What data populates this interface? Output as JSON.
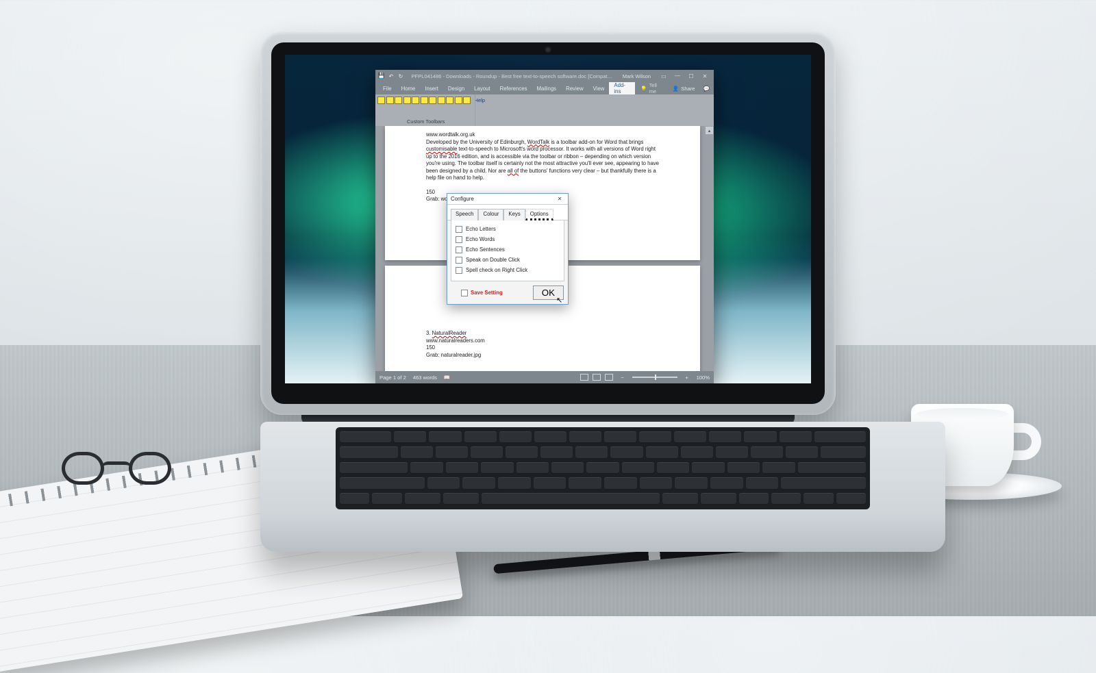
{
  "title": {
    "doc": "PFPL041486 - Downloads - Roundup - Best free text-to-speech software.doc [Compat…",
    "user": "Mark Wilson"
  },
  "menu": {
    "items": [
      "File",
      "Home",
      "Insert",
      "Design",
      "Layout",
      "References",
      "Mailings",
      "Review",
      "View",
      "Add-ins"
    ],
    "active": "Add-ins",
    "tell_me": "Tell me",
    "share": "Share"
  },
  "ribbon": {
    "help": "Help",
    "group": "Custom Toolbars"
  },
  "doc": {
    "url": "www.wordtalk.org.uk",
    "p1a": "Developed by the University of Edinburgh, ",
    "p1_link": "WordTalk",
    "p1b": " is a toolbar add-on for Word that brings ",
    "p1_link2": "customisable",
    "p1c": " text-to-speech to Microsoft's word processor. It works with all versions of Word right up to the 2016 edition, and is accessible via the toolbar or ribbon – depending on which version you're using. The toolbar itself is certainly not the most attractive you'll ever see, appearing to have been designed by a child. Nor are ",
    "p1_link3": "all of",
    "p1d": " the buttons' functions very clear – but thankfully there is a help file on hand to help.",
    "p1_150": "150",
    "p1_grab": "Grab: wor",
    "sec3_title": "3. ",
    "sec3_link": "NaturalReader",
    "sec3_url": "www.naturalreaders.com",
    "sec3_150": "150",
    "sec3_grab": "Grab: naturalreader.jpg"
  },
  "dialog": {
    "title": "Configure",
    "tabs": [
      "Speech",
      "Colour",
      "Keys",
      "Options"
    ],
    "active_tab": "Options",
    "options": [
      "Echo Letters",
      "Echo Words",
      "Echo Sentences",
      "Speak on Double Click",
      "Spell check on Right Click"
    ],
    "save": "Save Setting",
    "ok": "OK"
  },
  "status": {
    "page": "Page 1 of 2",
    "words": "463 words",
    "zoom": "100%"
  }
}
